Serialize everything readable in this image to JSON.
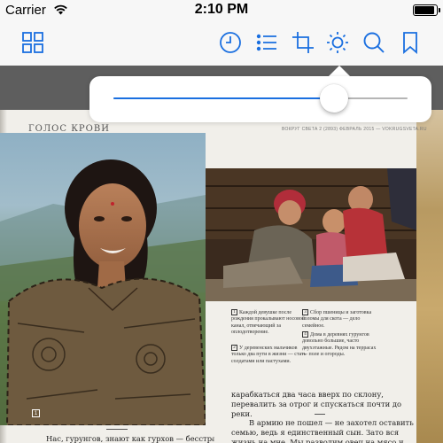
{
  "status_bar": {
    "carrier": "Carrier",
    "time": "2:10 PM",
    "battery_level": 1.0
  },
  "toolbar": {
    "accent_color": "#1a6fe0",
    "buttons": [
      {
        "name": "grid-icon"
      },
      {
        "name": "clock-icon"
      },
      {
        "name": "list-icon"
      },
      {
        "name": "crop-icon"
      },
      {
        "name": "brightness-icon"
      },
      {
        "name": "search-icon"
      },
      {
        "name": "bookmark-icon"
      }
    ]
  },
  "brightness_popover": {
    "slider_value": 0.75
  },
  "magazine_page": {
    "title": "ГОЛОС КРОВИ",
    "header": "ВОКРУГ СВЕТА  2 (2893) ФЕВРАЛЬ 2015 — VOKRUGSVETA.RU",
    "captions_left": [
      {
        "num": "1",
        "text": "Каждой девушке после рождения прокалывают носовой канал, отвечающий за оплодотворение."
      },
      {
        "num": "2",
        "text": "У деревенских мальчиков только два пути в жизни — стать солдатами или пастухами."
      }
    ],
    "captions_right": [
      {
        "num": "3",
        "text": "Сбор пшеницы и заготовка соломы для скота — дело семейное."
      },
      {
        "num": "4",
        "text": "Дома в деревнях гурунгов довольно большие, часто двухэтажные. Рядом на террасах — поле и огороды."
      }
    ],
    "body_paragraphs": [
      "карабкаться два часа вверх по склону, перевалить за отрог и спускаться почти до реки.",
      "В армию не пошел — не захотел оставить семью, ведь я единственный сын. Зато вся жизнь на мне. Мы разводим овец на мясо и шерсть. В нашей деревне обычно по одной-"
    ],
    "left_footer_text": "Нас, гурунгов, знают как гурхов — бесстрашных",
    "fig_label": "1"
  }
}
